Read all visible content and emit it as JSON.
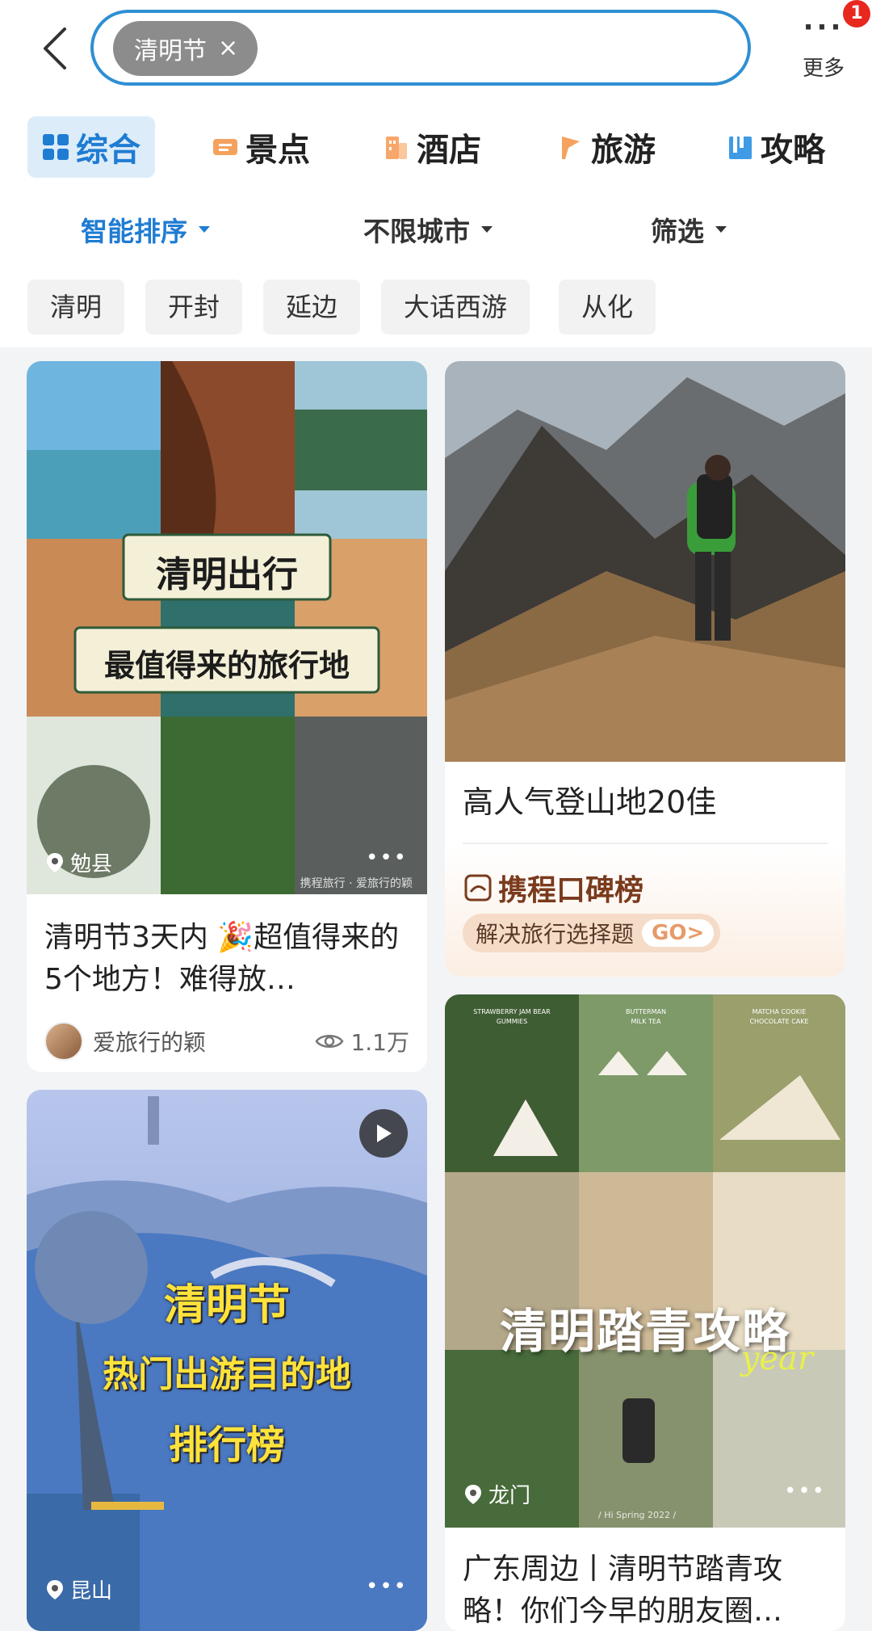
{
  "header": {
    "search_chip": "清明节",
    "chip_close": "×",
    "more_label": "更多",
    "more_dots": "···",
    "badge_count": "1"
  },
  "tabs": [
    {
      "label": "综合",
      "icon": "grid-icon",
      "active": true
    },
    {
      "label": "景点",
      "icon": "ticket-icon"
    },
    {
      "label": "酒店",
      "icon": "hotel-icon"
    },
    {
      "label": "旅游",
      "icon": "flag-icon"
    },
    {
      "label": "攻略",
      "icon": "book-icon"
    }
  ],
  "sort": {
    "smart": "智能排序",
    "city": "不限城市",
    "filter": "筛选"
  },
  "keywords": [
    "清明",
    "开封",
    "延边",
    "大话西游",
    "从化"
  ],
  "cards": {
    "c1": {
      "overlay_line1": "清明出行",
      "overlay_line2": "最值得来的旅行地",
      "location": "勉县",
      "watermark": "携程旅行 · 爱旅行的颖",
      "title": "清明节3天内 🎉超值得来的5个地方！难得放…",
      "author": "爱旅行的颖",
      "views": "1.1万"
    },
    "c2": {
      "title": "高人气登山地20佳",
      "brand": "携程口碑榜",
      "cta": "解决旅行选择题",
      "cta_go": "GO>"
    },
    "c3": {
      "overlay_line1": "清明节",
      "overlay_line2": "热门出游目的地",
      "overlay_line3": "排行榜",
      "location": "昆山"
    },
    "c4": {
      "overlay": "清明踏青攻略",
      "script": "year",
      "photo_labels": [
        "STRAWBERRY JAM BEAR GUMMIES",
        "BUTTERMAN MILK TEA",
        "MATCHA COOKIE CHOCOLATE CAKE"
      ],
      "photo_caption": "/ Hi Spring 2022 /",
      "location": "龙门",
      "title": "广东周边丨清明节踏青攻略！你们今早的朋友圈…"
    }
  },
  "colors": {
    "accent": "#1f7cd3",
    "search_border": "#2f8fd3",
    "badge": "#e8271e"
  }
}
